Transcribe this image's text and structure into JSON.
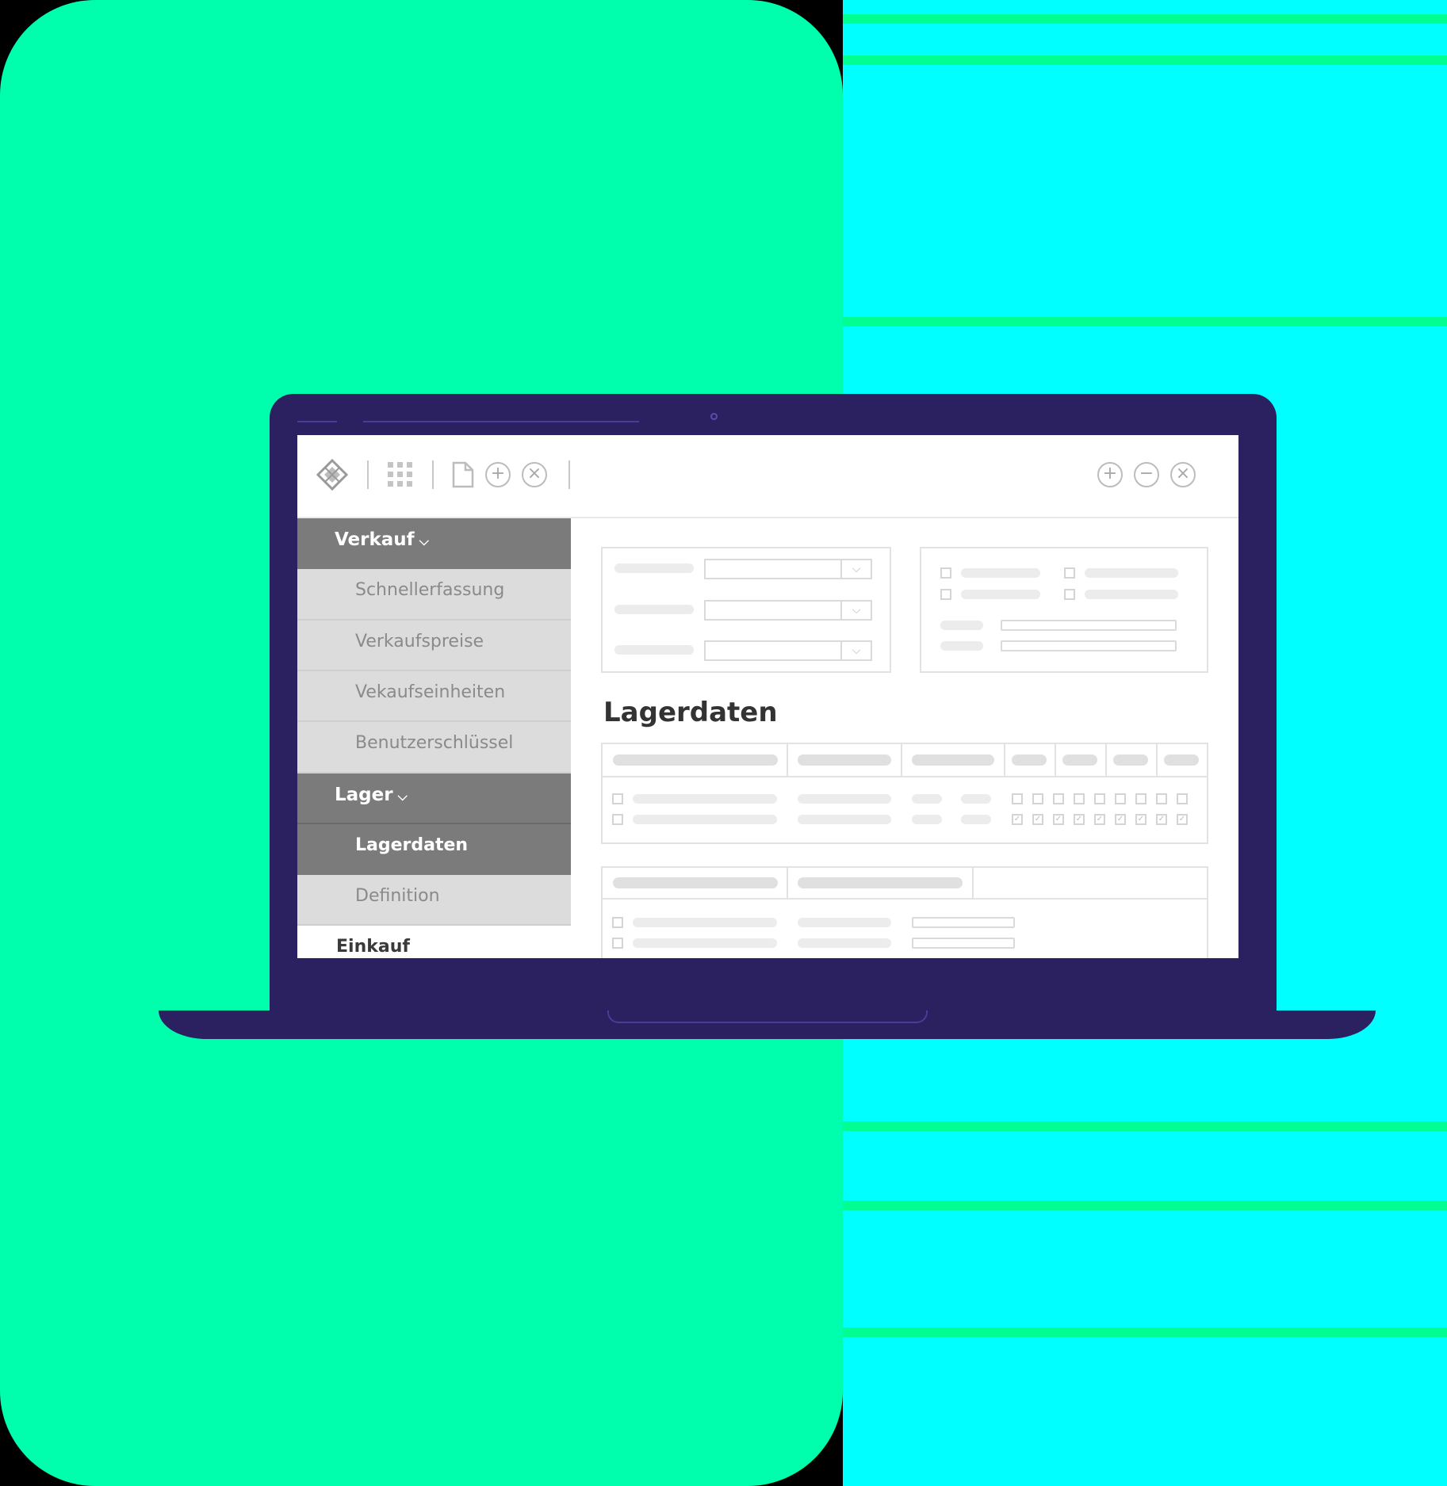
{
  "colors": {
    "background_left": "#00ffad",
    "background_right": "#00ffff",
    "laptop": "#2b2160",
    "sidebar_active": "#7b7b7b",
    "sidebar_item": "#dcdcdc"
  },
  "toolbar": {
    "icons_left": [
      "app-logo-icon",
      "apps-grid-icon",
      "new-document-icon",
      "add-circle-icon",
      "close-circle-icon"
    ],
    "icons_right": [
      "zoom-in-icon",
      "zoom-out-icon",
      "close-window-icon"
    ]
  },
  "sidebar": {
    "group_sales": "Verkauf",
    "items_sales": [
      "Schnellerfassung",
      "Verkaufspreise",
      "Vekaufseinheiten",
      "Benutzerschlüssel"
    ],
    "group_stock": "Lager",
    "items_stock": [
      "Lagerdaten",
      "Definition"
    ],
    "group_purchase": "Einkauf",
    "selected": "Lagerdaten"
  },
  "main": {
    "section_title": "Lagerdaten"
  }
}
